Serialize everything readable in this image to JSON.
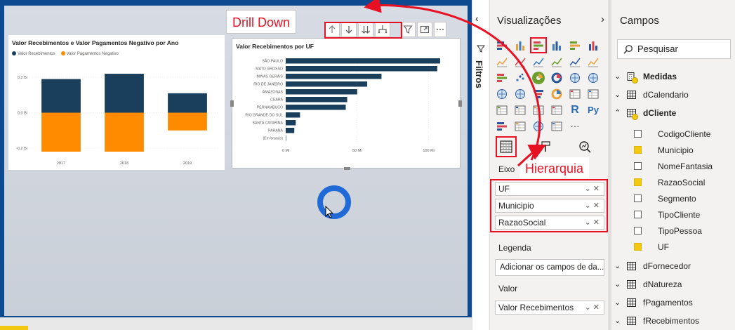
{
  "report": {
    "callouts": {
      "drill": "Drill Down",
      "hierarchy": "Hierarquia"
    },
    "visual1": {
      "title": "Valor Recebimentos e Valor Pagamentos Negativo por Ano",
      "legend": [
        "Valor Recebimentos",
        "Valor Pagamentos Negativo"
      ],
      "colors": [
        "#1a3f5c",
        "#ff8c00"
      ]
    },
    "visual2": {
      "title": "Valor Recebimentos por UF",
      "color": "#1a3f5c"
    }
  },
  "chart_data": [
    {
      "type": "bar",
      "title": "Valor Recebimentos e Valor Pagamentos Negativo por Ano",
      "categories": [
        "2017",
        "2018",
        "2019"
      ],
      "series": [
        {
          "name": "Valor Recebimentos",
          "values": [
            0.19,
            0.22,
            0.11
          ]
        },
        {
          "name": "Valor Pagamentos Negativo",
          "values": [
            -0.22,
            -0.22,
            -0.1
          ]
        }
      ],
      "y_ticks": [
        "0,2 Bi",
        "0,0 Bi",
        "-0,2 Bi"
      ],
      "ylim": [
        -0.22,
        0.24
      ],
      "legend": "top-left",
      "grid": true
    },
    {
      "type": "bar",
      "orientation": "horizontal",
      "title": "Valor Recebimentos por UF",
      "categories": [
        "SÃO PAULO",
        "MATO GROSSO",
        "MINAS GERAIS",
        "RIO DE JANEIRO",
        "AMAZONAS",
        "CEARÁ",
        "PERNAMBUCO",
        "RIO GRANDE DO SUL",
        "SANTA CATARINA",
        "PARANÁ",
        "(Em branco)"
      ],
      "values": [
        108,
        106,
        67,
        57,
        50,
        43,
        42,
        10,
        7,
        6,
        0
      ],
      "x_ticks": [
        "0 Mi",
        "50 Mi",
        "100 Mi"
      ],
      "xlim": [
        0,
        110
      ],
      "grid": true
    }
  ],
  "filters": {
    "label": "Filtros"
  },
  "visualizations": {
    "title": "Visualizações",
    "icons": [
      "stacked-bar-icon",
      "stacked-column-icon",
      "clustered-bar-icon",
      "clustered-column-icon",
      "100-bar-icon",
      "100-column-icon",
      "line-chart-icon",
      "area-chart-icon",
      "stacked-area-icon",
      "line-column-icon",
      "line-clustered-icon",
      "ribbon-chart-icon",
      "waterfall-icon",
      "scatter-icon",
      "pie-icon",
      "donut-icon",
      "treemap-icon",
      "map-icon",
      "filled-map-icon",
      "shape-map-icon",
      "funnel-icon",
      "gauge-icon",
      "card-icon",
      "multirow-card-icon",
      "kpi-icon",
      "slicer-icon",
      "table-icon",
      "matrix-icon",
      "r-visual-icon",
      "python-visual-icon",
      "key-influencers-icon",
      "qa-icon",
      "arcgis-icon",
      "custom-visual-icon",
      "more-icon"
    ],
    "more_label": "···",
    "r_label": "R",
    "py_label": "Py",
    "wells": {
      "axis_label": "Eixo",
      "axis_fields": [
        "UF",
        "Municipio",
        "RazaoSocial"
      ],
      "legend_label": "Legenda",
      "legend_placeholder": "Adicionar os campos de da...",
      "value_label": "Valor",
      "value_fields": [
        "Valor Recebimentos"
      ]
    }
  },
  "fields": {
    "title": "Campos",
    "search_placeholder": "Pesquisar",
    "tables": [
      {
        "name": "Medidas",
        "expanded": false
      },
      {
        "name": "dCalendario",
        "expanded": false
      },
      {
        "name": "dCliente",
        "expanded": true
      },
      {
        "name": "dFornecedor",
        "expanded": false
      },
      {
        "name": "dNatureza",
        "expanded": false
      },
      {
        "name": "fPagamentos",
        "expanded": false
      },
      {
        "name": "fRecebimentos",
        "expanded": false
      }
    ],
    "dcliente_fields": [
      {
        "name": "CodigoCliente",
        "checked": false
      },
      {
        "name": "Municipio",
        "checked": true
      },
      {
        "name": "NomeFantasia",
        "checked": false
      },
      {
        "name": "RazaoSocial",
        "checked": true
      },
      {
        "name": "Segmento",
        "checked": false
      },
      {
        "name": "TipoCliente",
        "checked": false
      },
      {
        "name": "TipoPessoa",
        "checked": false
      },
      {
        "name": "UF",
        "checked": true
      }
    ]
  }
}
